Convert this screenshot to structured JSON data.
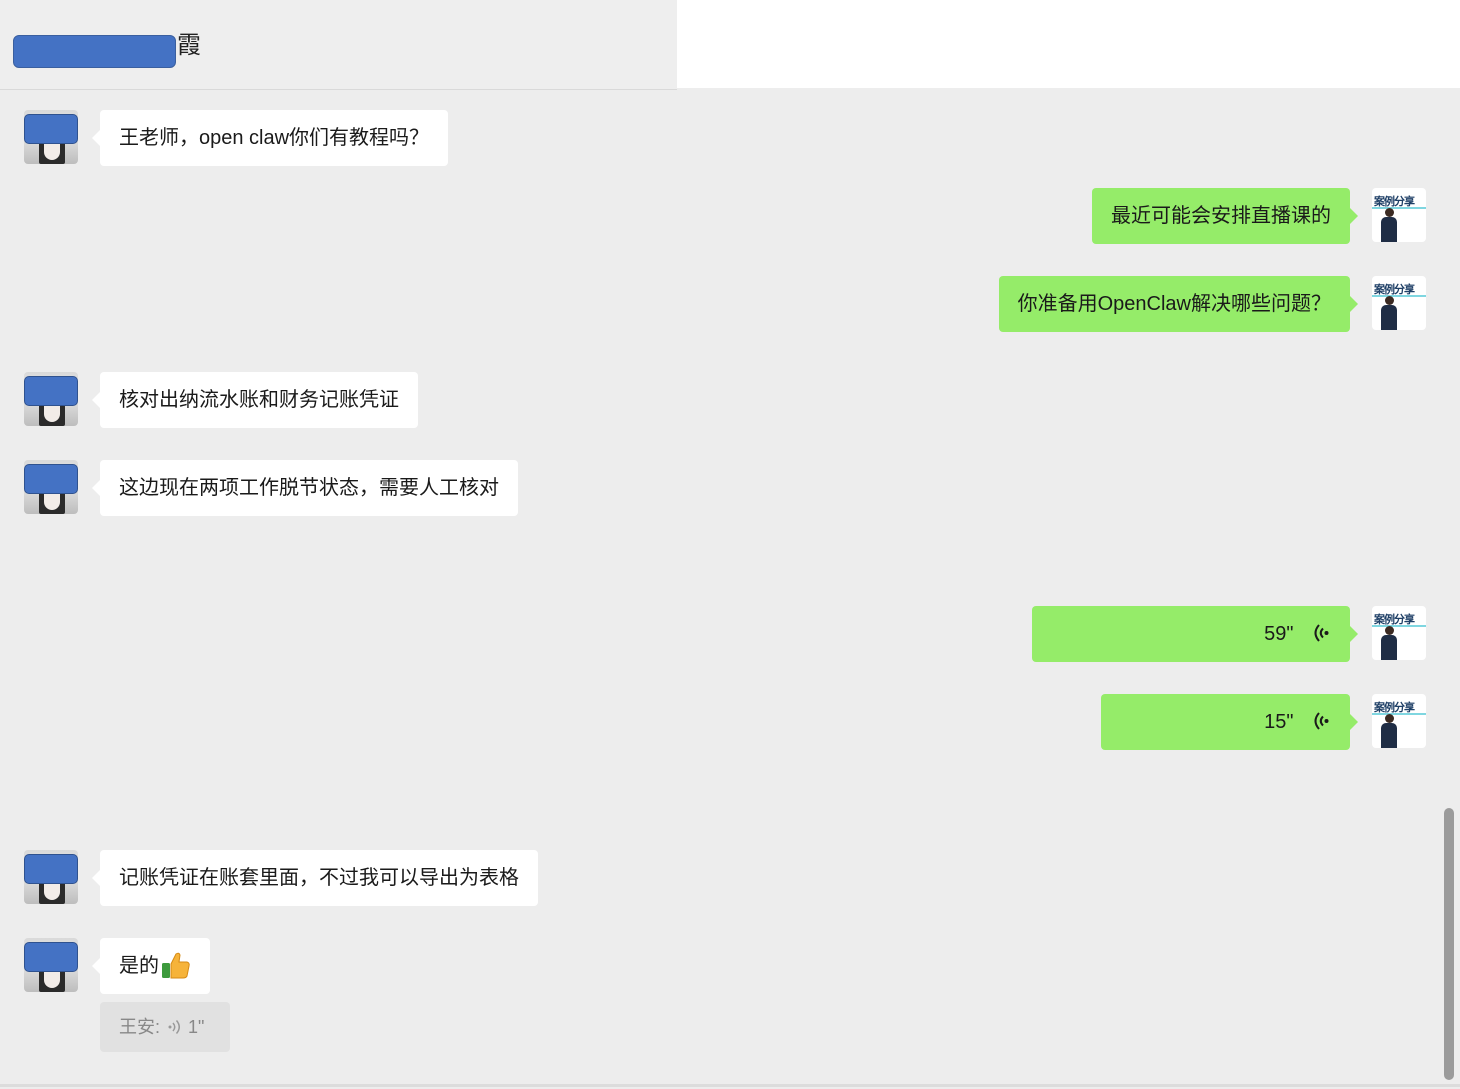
{
  "header": {
    "title_suffix": "霞"
  },
  "messages": [
    {
      "side": "left",
      "type": "text",
      "text": "王老师，open claw你们有教程吗？"
    },
    {
      "side": "right",
      "type": "text",
      "text": "最近可能会安排直播课的"
    },
    {
      "side": "right",
      "type": "text",
      "text": "你准备用OpenClaw解决哪些问题？"
    },
    {
      "side": "left",
      "type": "text",
      "text": "核对出纳流水账和财务记账凭证"
    },
    {
      "side": "left",
      "type": "text",
      "text": "这边现在两项工作脱节状态，需要人工核对"
    },
    {
      "side": "right",
      "type": "voice",
      "duration": "59\""
    },
    {
      "side": "right",
      "type": "voice",
      "duration": "15\""
    },
    {
      "side": "left",
      "type": "text",
      "text": "记账凭证在账套里面，不过我可以导出为表格"
    },
    {
      "side": "left",
      "type": "text",
      "text": "是的",
      "emoji": "thumbs-up"
    }
  ],
  "quote": {
    "sender": "王安:",
    "duration": "1\""
  },
  "right_avatar": {
    "label": "案例分享"
  },
  "colors": {
    "background": "#ededed",
    "bubble_self": "#95ec69",
    "bubble_other": "#ffffff",
    "redaction": "#4472c4"
  }
}
